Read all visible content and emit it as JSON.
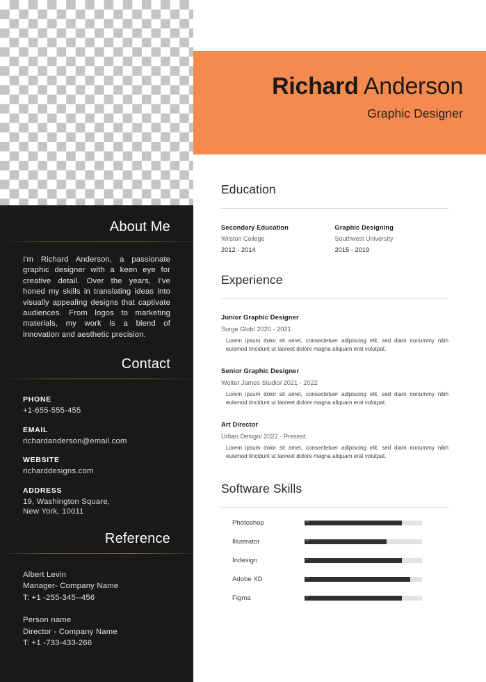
{
  "colors": {
    "accent_orange": "#f48a4e",
    "sidebar_dark": "#191919",
    "skill_fill": "#303030",
    "skill_track": "#e2e2e2",
    "rule_light": "#d8d8d8"
  },
  "header": {
    "first_name": "Richard",
    "last_name": "Anderson",
    "job_title": "Graphic Designer"
  },
  "sidebar": {
    "about": {
      "heading": "About Me",
      "text": "I'm Richard Anderson, a passionate graphic designer with a keen eye for creative detail. Over the years, I've honed my skills in translating ideas into visually appealing designs that captivate audiences. From logos to marketing materials, my work is a blend of innovation and aesthetic precision."
    },
    "contact": {
      "heading": "Contact",
      "items": [
        {
          "label": "PHONE",
          "value": "+1-655-555-455"
        },
        {
          "label": "EMAIL",
          "value": "richardanderson@email.com"
        },
        {
          "label": "WEBSITE",
          "value": "richarddesigns.com"
        },
        {
          "label": "ADDRESS",
          "value": "19, Washington Square,\nNew York, 10011"
        }
      ]
    },
    "reference": {
      "heading": "Reference",
      "items": [
        {
          "name": "Albert Levin",
          "role": "Manager- Company Name",
          "phone": "T: +1 -255-345--456"
        },
        {
          "name": "Person name",
          "role": "Director - Company Name",
          "phone": "T: +1 -733-433-266"
        }
      ]
    }
  },
  "main": {
    "education": {
      "heading": "Education",
      "items": [
        {
          "title": "Secondary Education",
          "school": "Wilston College",
          "years": "2012 - 2014"
        },
        {
          "title": "Graphic Designing",
          "school": "Southwest University",
          "years": "2015 - 2019"
        }
      ]
    },
    "experience": {
      "heading": "Experience",
      "items": [
        {
          "role": "Junior Graphic Designer",
          "meta": "Surge Glob/ 2020 - 2021",
          "desc": "Lorem ipsum dolor sit amet, consectetuer adipiscing elit, sed diam nonummy nibh euismod tincidunt ut laoreet dolore magna aliquam erat volutpat."
        },
        {
          "role": "Senior Graphic Designer",
          "meta": "Wolter James Studio/ 2021 - 2022",
          "desc": "Lorem ipsum dolor sit amet, consectetuer adipiscing elit, sed diam nonummy nibh euismod tincidunt ut laoreet dolore magna aliquam erat volutpat."
        },
        {
          "role": "Art Director",
          "meta": "Urban Design/ 2022 - Present",
          "desc": "Lorem ipsum dolor sit amet, consectetuer adipiscing elit, sed diam nonummy nibh euismod tincidunt ut laoreet dolore magna aliquam erat volutpat."
        }
      ]
    },
    "skills": {
      "heading": "Software Skills",
      "items": [
        {
          "name": "Photoshop",
          "level": 83
        },
        {
          "name": "Illustrator",
          "level": 70
        },
        {
          "name": "Indesign",
          "level": 83
        },
        {
          "name": "Adobe XD",
          "level": 90
        },
        {
          "name": "Figma",
          "level": 83
        }
      ]
    }
  }
}
